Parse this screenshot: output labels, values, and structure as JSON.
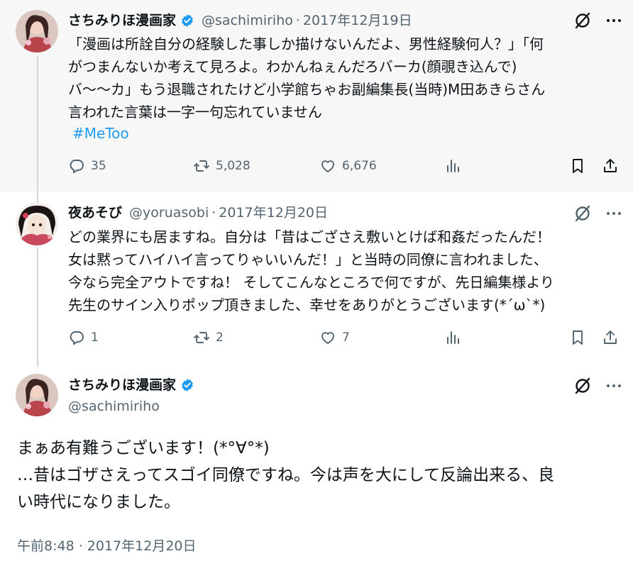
{
  "tweet1": {
    "display_name": "さちみりほ漫画家",
    "handle": "@sachimiriho",
    "separator": "·",
    "date": "2017年12月19日",
    "text": "「漫画は所詮自分の経験した事しか描けないんだよ、男性経験何人？」「何\nがつまんないか考えて見ろよ。わかんねぇんだろバーカ(顔覗き込んで)\nバ〜〜カ」もう退職されたけど小学館ちゃお副編集長(当時)M田あきらさん\n言われた言葉は一字一句忘れていません",
    "hashtag": "#MeToo",
    "replies": "35",
    "retweets": "5,028",
    "likes": "6,676"
  },
  "tweet2": {
    "display_name": "夜あそび",
    "handle": "@yoruasobi",
    "separator": "·",
    "date": "2017年12月20日",
    "text": "どの業界にも居ますね。自分は「昔はござさえ敷いとけば和姦だったんだ！\n女は黙ってハイハイ言ってりゃいいんだ！」と当時の同僚に言われました、\n今なら完全アウトですね！ そしてこんなところで何ですが、先日編集様より\n先生のサイン入りポップ頂きました、幸せをありがとうございます(*´ω`*)",
    "replies": "1",
    "retweets": "2",
    "likes": "7"
  },
  "tweet3": {
    "display_name": "さちみりほ漫画家",
    "handle": "@sachimiriho",
    "text": "まぁあ有難うございます！(*°∀°*)\n…昔はゴザさえってスゴイ同僚ですね。今は声を大にして反論出来る、良\nい時代になりました。",
    "timestamp": "午前8:48 · 2017年12月20日"
  },
  "colors": {
    "accent": "#1d9bf0",
    "secondary_text": "#536471",
    "highlight_bg": "#f7f7f7"
  },
  "icons": [
    "verified-badge-icon",
    "grok-icon",
    "more-icon",
    "reply-icon",
    "retweet-icon",
    "like-icon",
    "views-icon",
    "bookmark-icon",
    "share-icon"
  ]
}
